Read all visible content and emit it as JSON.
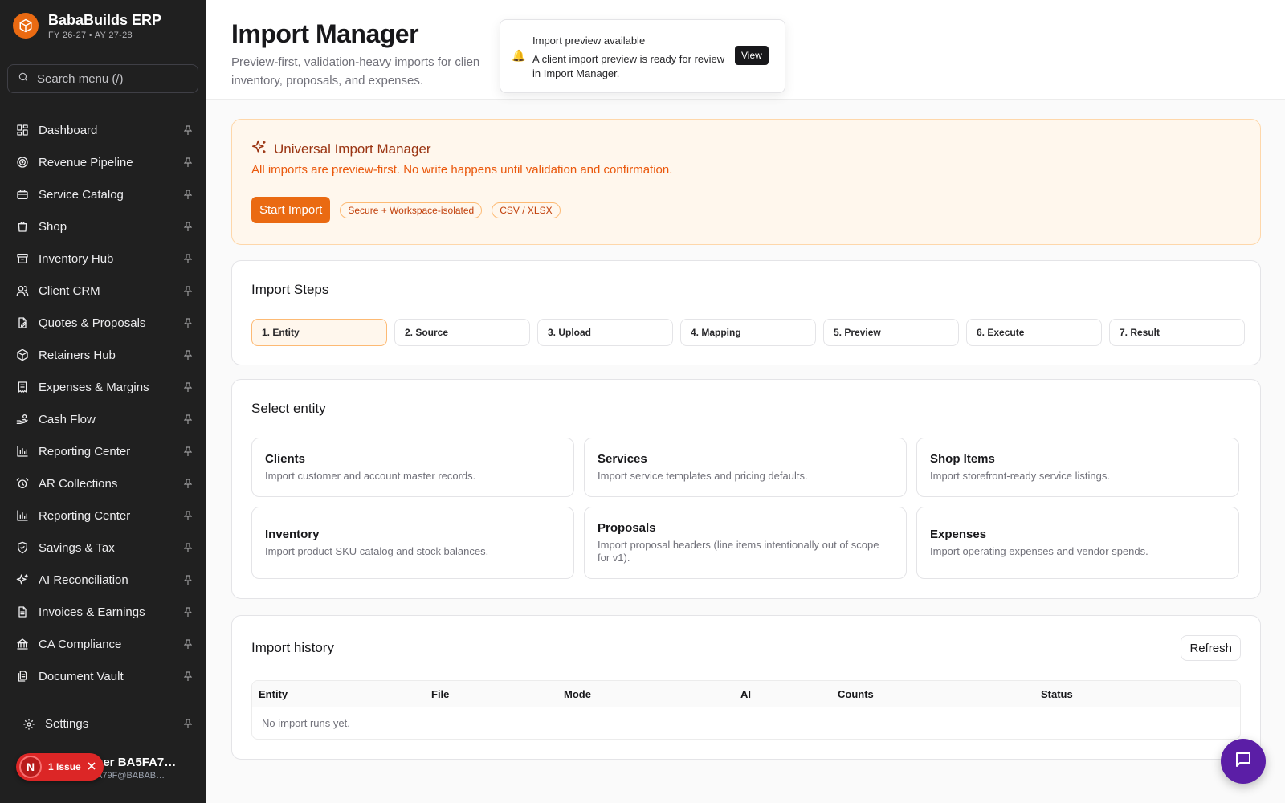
{
  "brand": {
    "title": "BabaBuilds ERP",
    "subtitle": "FY 26-27 • AY 27-28"
  },
  "search": {
    "placeholder": "Search menu (/)"
  },
  "sidebar": {
    "items": [
      {
        "label": "Dashboard",
        "icon": "grid-icon"
      },
      {
        "label": "Revenue Pipeline",
        "icon": "target-icon"
      },
      {
        "label": "Service Catalog",
        "icon": "briefcase-icon"
      },
      {
        "label": "Shop",
        "icon": "shopping-bag-icon"
      },
      {
        "label": "Inventory Hub",
        "icon": "archive-icon"
      },
      {
        "label": "Client CRM",
        "icon": "users-icon"
      },
      {
        "label": "Quotes & Proposals",
        "icon": "file-edit-icon"
      },
      {
        "label": "Retainers Hub",
        "icon": "box-icon"
      },
      {
        "label": "Expenses & Margins",
        "icon": "receipt-icon"
      },
      {
        "label": "Cash Flow",
        "icon": "hand-coins-icon"
      },
      {
        "label": "Reporting Center",
        "icon": "bar-chart-icon"
      },
      {
        "label": "AR Collections",
        "icon": "alarm-icon"
      },
      {
        "label": "Reporting Center",
        "icon": "bar-chart-icon"
      },
      {
        "label": "Savings & Tax",
        "icon": "shield-icon"
      },
      {
        "label": "AI Reconciliation",
        "icon": "sparkles-icon"
      },
      {
        "label": "Invoices & Earnings",
        "icon": "file-text-icon"
      },
      {
        "label": "CA Compliance",
        "icon": "landmark-icon"
      },
      {
        "label": "Document Vault",
        "icon": "file-stack-icon"
      }
    ],
    "settings_label": "Settings",
    "user_name": "ser BA5FA7…",
    "user_email": "A79F@BABAB…",
    "issue_avatar": "N",
    "issue_label": "1 Issue"
  },
  "header": {
    "title": "Import Manager",
    "description": "Preview-first, validation-heavy imports for clien inventory, proposals, and expenses."
  },
  "toast": {
    "title": "Import preview available",
    "message": "A client import preview is ready for review in Import Manager.",
    "action": "View"
  },
  "hero": {
    "title": "Universal Import Manager",
    "subtitle": "All imports are preview-first. No write happens until validation and confirmation.",
    "start_button": "Start Import",
    "chips": [
      "Secure + Workspace-isolated",
      "CSV / XLSX"
    ]
  },
  "steps": {
    "title": "Import Steps",
    "items": [
      "1. Entity",
      "2. Source",
      "3. Upload",
      "4. Mapping",
      "5. Preview",
      "6. Execute",
      "7. Result"
    ],
    "active_index": 0
  },
  "entity": {
    "title": "Select entity",
    "options": [
      {
        "title": "Clients",
        "desc": "Import customer and account master records."
      },
      {
        "title": "Services",
        "desc": "Import service templates and pricing defaults."
      },
      {
        "title": "Shop Items",
        "desc": "Import storefront-ready service listings."
      },
      {
        "title": "Inventory",
        "desc": "Import product SKU catalog and stock balances."
      },
      {
        "title": "Proposals",
        "desc": "Import proposal headers (line items intentionally out of scope for v1)."
      },
      {
        "title": "Expenses",
        "desc": "Import operating expenses and vendor spends."
      }
    ]
  },
  "history": {
    "title": "Import history",
    "refresh": "Refresh",
    "columns": [
      "Entity",
      "File",
      "Mode",
      "AI",
      "Counts",
      "Status"
    ],
    "empty": "No import runs yet."
  },
  "colors": {
    "accent": "#ea6a12",
    "sidebar_bg": "#202020",
    "chat_fab": "#5b1ea6",
    "issue": "#dc2626"
  }
}
